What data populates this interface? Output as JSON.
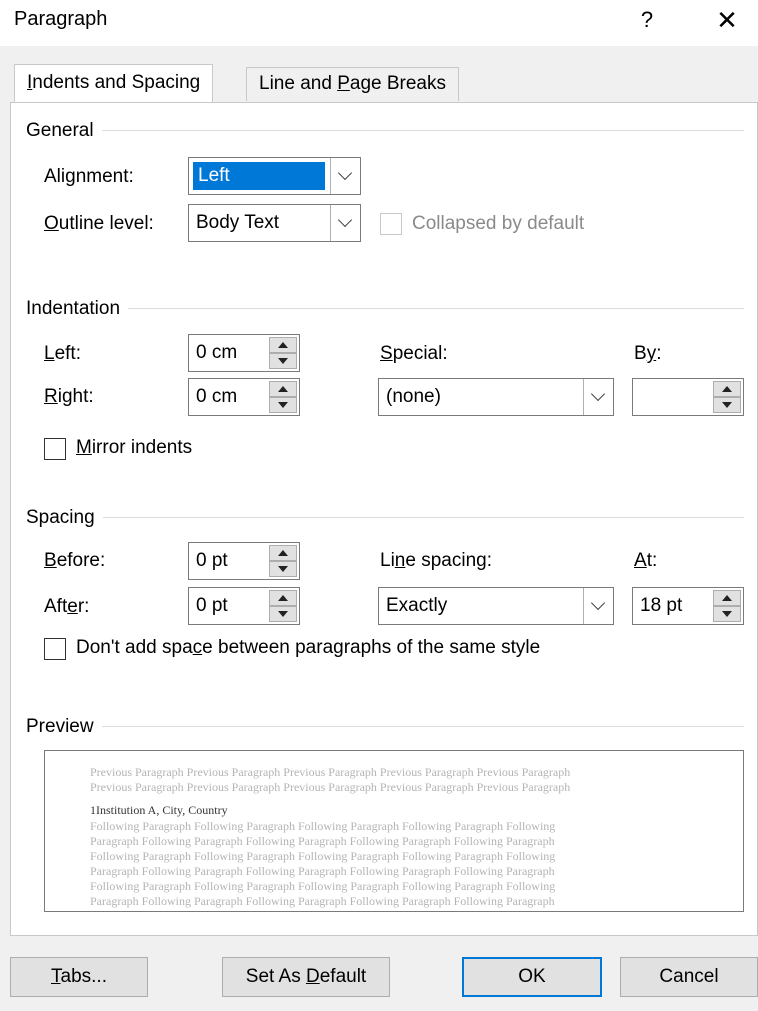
{
  "dialog": {
    "title": "Paragraph",
    "help": "?",
    "close": "✕"
  },
  "tabs": [
    {
      "label": "Indents and Spacing",
      "underline_char": "I",
      "rest": "ndents and Spacing"
    },
    {
      "pre": "Line and ",
      "underline_char": "P",
      "rest": "age Breaks",
      "label": "Line and Page Breaks"
    }
  ],
  "general": {
    "title": "General",
    "alignment": {
      "pre": "Ali",
      "u": "g",
      "post": "nment:",
      "label": "Alignment:",
      "value": "Left"
    },
    "outline": {
      "pre": "",
      "u": "O",
      "post": "utline level:",
      "label": "Outline level:",
      "value": "Body Text"
    },
    "collapsed": {
      "label": "Collapsed by default",
      "checked": false,
      "enabled": false
    }
  },
  "indentation": {
    "title": "Indentation",
    "left": {
      "pre": "",
      "u": "L",
      "post": "eft:",
      "label": "Left:",
      "value": "0 cm"
    },
    "right": {
      "pre": "",
      "u": "R",
      "post": "ight:",
      "label": "Right:",
      "value": "0 cm"
    },
    "special": {
      "pre": "",
      "u": "S",
      "post": "pecial:",
      "label": "Special:",
      "value": "(none)"
    },
    "by": {
      "pre": "B",
      "u": "y",
      "post": ":",
      "label": "By:",
      "value": ""
    },
    "mirror": {
      "pre": "",
      "u": "M",
      "post": "irror indents",
      "label": "Mirror indents",
      "checked": false
    }
  },
  "spacing": {
    "title": "Spacing",
    "before": {
      "pre": "",
      "u": "B",
      "post": "efore:",
      "label": "Before:",
      "value": "0 pt"
    },
    "after": {
      "pre": "Aft",
      "u": "e",
      "post": "r:",
      "label": "After:",
      "value": "0 pt"
    },
    "line_spacing": {
      "pre": "Li",
      "u": "n",
      "post": "e spacing:",
      "label": "Line spacing:",
      "value": "Exactly"
    },
    "at": {
      "pre": "",
      "u": "A",
      "post": "t:",
      "label": "At:",
      "value": "18 pt"
    },
    "dont_add": {
      "pre": "Don't add spa",
      "u": "c",
      "post": "e between paragraphs of the same style",
      "label": "Don't add space between paragraphs of the same style",
      "checked": false
    }
  },
  "preview": {
    "title": "Preview",
    "previous_lines": [
      "Previous Paragraph Previous Paragraph Previous Paragraph Previous Paragraph Previous Paragraph",
      "Previous Paragraph Previous Paragraph Previous Paragraph Previous Paragraph Previous Paragraph"
    ],
    "current_line": "1Institution A, City, Country",
    "following_lines": [
      "Following Paragraph Following Paragraph Following Paragraph Following Paragraph Following",
      "Paragraph Following Paragraph Following Paragraph Following Paragraph Following Paragraph",
      "Following Paragraph Following Paragraph Following Paragraph Following Paragraph Following",
      "Paragraph Following Paragraph Following Paragraph Following Paragraph Following Paragraph",
      "Following Paragraph Following Paragraph Following Paragraph Following Paragraph Following",
      "Paragraph Following Paragraph Following Paragraph Following Paragraph Following Paragraph"
    ]
  },
  "buttons": {
    "tabs": {
      "pre": "",
      "u": "T",
      "post": "abs...",
      "label": "Tabs..."
    },
    "set_default": {
      "pre": "Set As ",
      "u": "D",
      "post": "efault",
      "label": "Set As Default"
    },
    "ok": {
      "label": "OK"
    },
    "cancel": {
      "label": "Cancel"
    }
  },
  "colors": {
    "accent": "#0078d7",
    "dialog_bg": "#f0f0f0",
    "panel_bg": "#ffffff",
    "preview_grey": "#b4b4b4"
  }
}
